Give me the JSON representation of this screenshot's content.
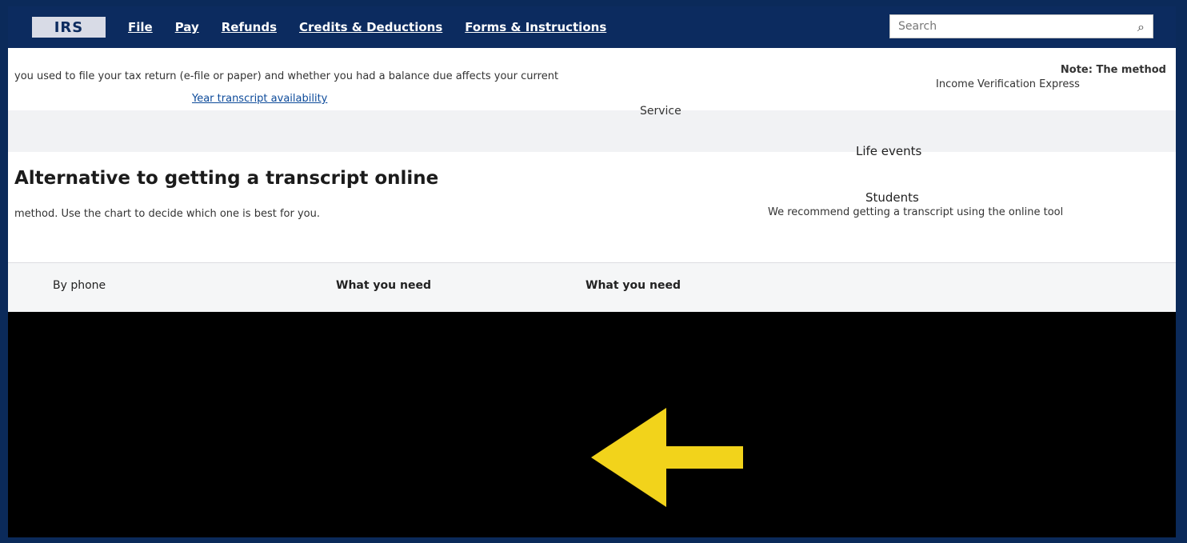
{
  "nav": {
    "logo_text": "IRS",
    "links": [
      "File",
      "Pay",
      "Refunds",
      "Credits & Deductions",
      "Forms & Instructions"
    ],
    "search_placeholder": "Search"
  },
  "content": {
    "intro_text": "you used to file your tax return (e-file or paper) and whether you had a balance due affects your current",
    "note_text": "Note: The method",
    "note_sub": "Income Verification Express",
    "transcript_link": "Year transcript availability",
    "service_label": "Service",
    "life_events": "Life events",
    "heading": "Alternative to getting a transcript online",
    "students": "Students",
    "recommend_text": "We recommend getting a transcript using the online tool",
    "method_text": "method. Use the chart to decide which one is best for you.",
    "table_cells": [
      "By phone",
      "What you need",
      "What you need"
    ]
  },
  "overlay": {
    "arrow_color": "#f2d31b",
    "arrow_icon": "left-arrow-icon"
  }
}
